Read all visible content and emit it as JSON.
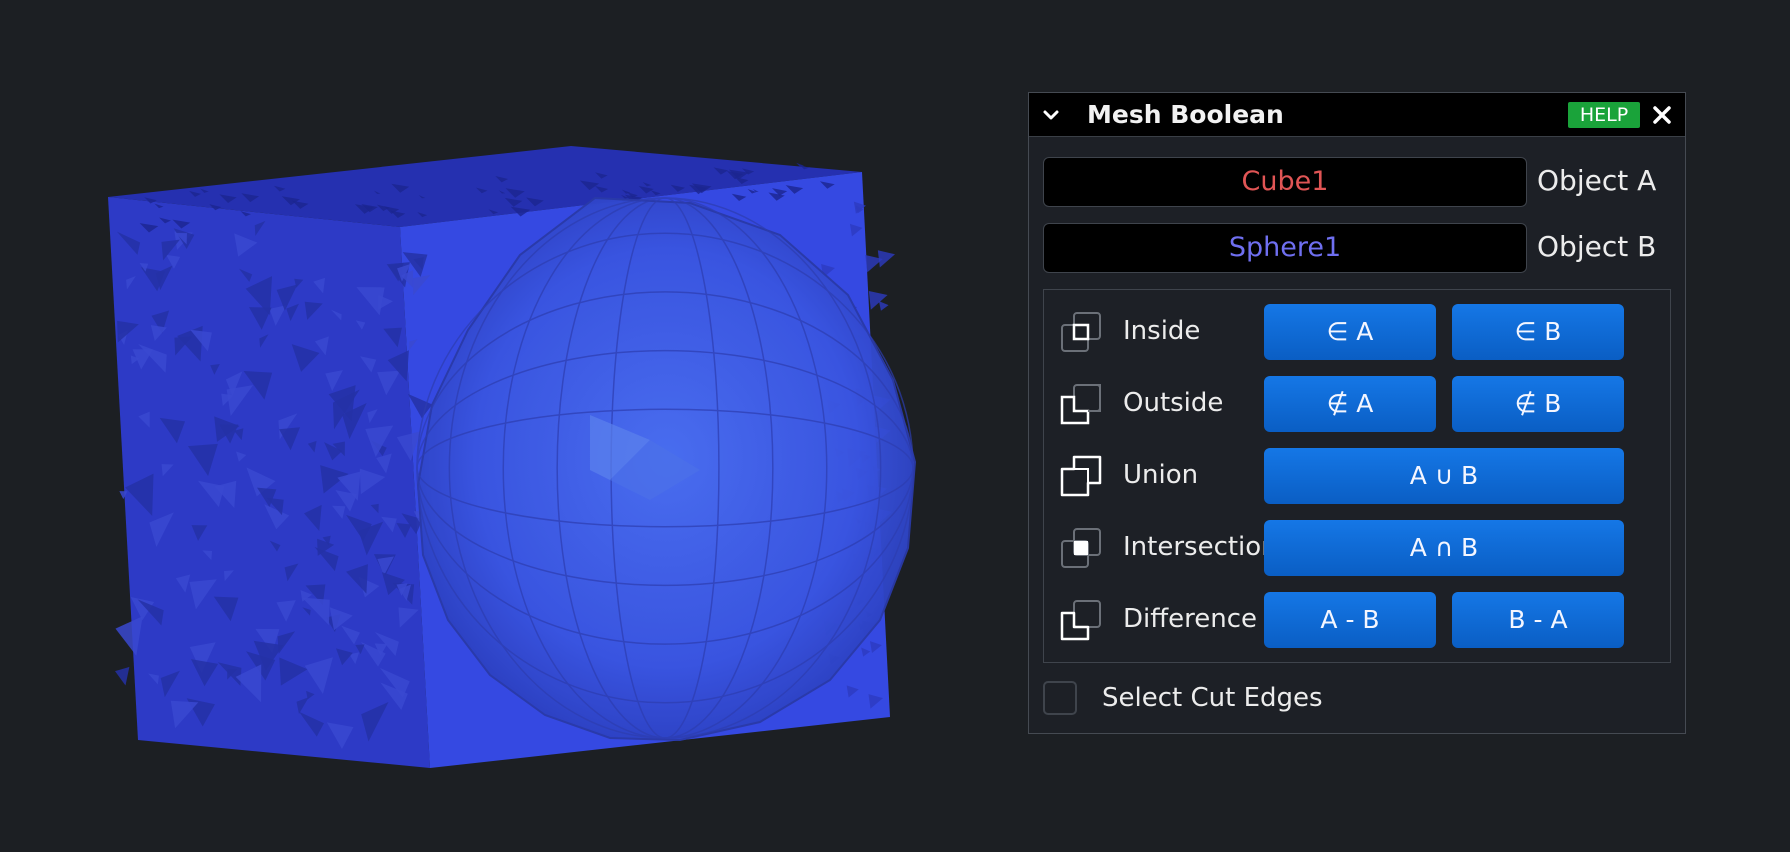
{
  "panel": {
    "title": "Mesh Boolean",
    "help_label": "HELP",
    "collapse_icon": "chevron-down-icon",
    "close_icon": "close-icon"
  },
  "objects": {
    "a": {
      "value": "Cube1",
      "label": "Object A",
      "color": "#e05555"
    },
    "b": {
      "value": "Sphere1",
      "label": "Object B",
      "color": "#6f6ff0"
    }
  },
  "operations": [
    {
      "label": "Inside",
      "icon": "inside-icon",
      "buttons": [
        "∈ A",
        "∈ B"
      ]
    },
    {
      "label": "Outside",
      "icon": "outside-icon",
      "buttons": [
        "∉ A",
        "∉ B"
      ]
    },
    {
      "label": "Union",
      "icon": "union-icon",
      "buttons": [
        "A ∪ B"
      ]
    },
    {
      "label": "Intersection",
      "icon": "intersection-icon",
      "buttons": [
        "A ∩ B"
      ]
    },
    {
      "label": "Difference",
      "icon": "difference-icon",
      "buttons": [
        "A - B",
        "B - A"
      ]
    }
  ],
  "select_cut_edges": {
    "label": "Select Cut Edges",
    "checked": false
  },
  "colors": {
    "background": "#1c1f23",
    "button": "#0a6ad8",
    "help": "#1aa33a",
    "mesh": "#3347d6"
  }
}
